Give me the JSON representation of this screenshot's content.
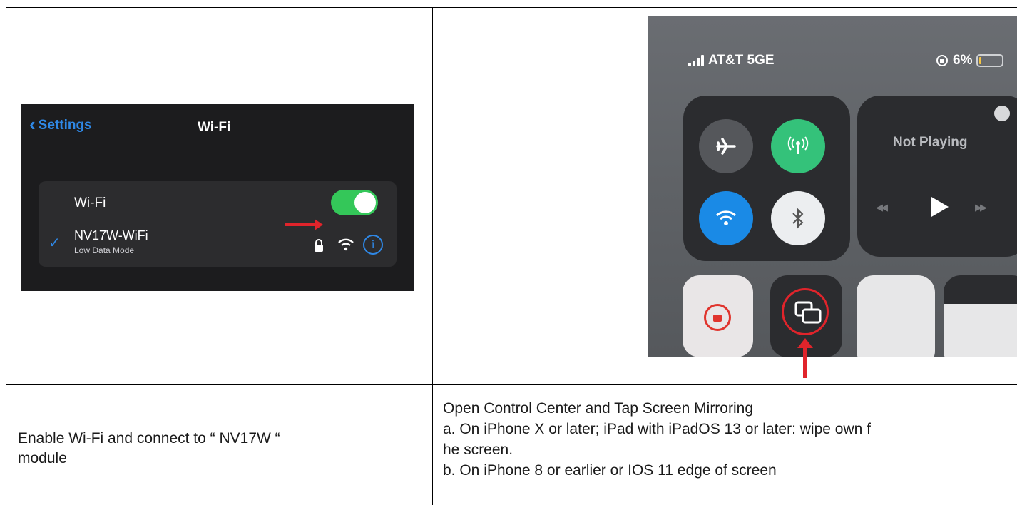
{
  "wifi_screenshot": {
    "back_label": "Settings",
    "title": "Wi-Fi",
    "wifi_row_label": "Wi-Fi",
    "wifi_enabled": true,
    "network_name": "NV17W-WiFi",
    "network_subtitle": "Low Data Mode",
    "icons": [
      "chevron-left-icon",
      "checkmark-icon",
      "lock-icon",
      "wifi-signal-icon",
      "info-icon",
      "red-arrow-icon"
    ]
  },
  "control_center_screenshot": {
    "carrier": "AT&T 5GE",
    "battery": "6%",
    "media_label": "Not Playing",
    "icons": [
      "airplane-icon",
      "cellular-icon",
      "wifi-icon",
      "bluetooth-icon",
      "airplay-icon",
      "previous-icon",
      "play-icon",
      "next-icon",
      "rotation-lock-icon",
      "screen-mirroring-icon",
      "red-arrow-icon"
    ]
  },
  "captions": {
    "left": [
      "Enable Wi-Fi and connect to “ NV17W “",
      "module"
    ],
    "right": [
      "Open Control Center and Tap Screen Mirroring",
      "a. On iPhone X or later; iPad with iPadOS 13 or later:  wipe  own f",
      "he screen.",
      "b. On iPhone 8 or earlier or IOS 11 edge of screen"
    ]
  },
  "colors": {
    "border": "#000000",
    "ios_blue": "#2f88e6",
    "ios_green": "#34c759",
    "annotation_red": "#e0242b"
  }
}
